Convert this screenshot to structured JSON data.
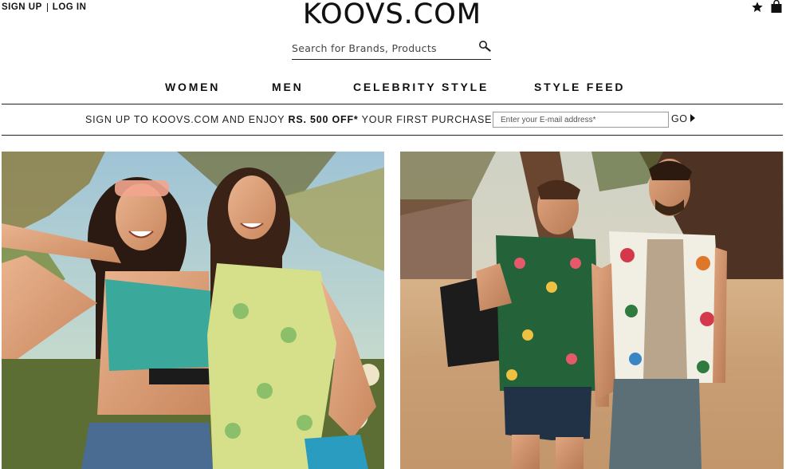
{
  "header": {
    "signup_label": "SIGN UP",
    "login_label": "LOG IN",
    "logo_text": "KOOVS.COM",
    "wishlist_icon": "star-icon",
    "bag_icon": "shopping-bag-icon"
  },
  "search": {
    "placeholder": "Search for Brands, Products",
    "icon": "search-icon"
  },
  "nav": {
    "items": [
      {
        "label": "WOMEN"
      },
      {
        "label": "MEN"
      },
      {
        "label": "CELEBRITY STYLE"
      },
      {
        "label": "STYLE FEED"
      }
    ]
  },
  "promo": {
    "text_before": "SIGN UP TO KOOVS.COM AND ENJOY ",
    "highlight": "RS. 500 OFF*",
    "text_after": " YOUR FIRST PURCHASE",
    "email_placeholder": "Enter your E-mail address*",
    "go_label": "GO",
    "go_icon": "play-arrow-icon"
  },
  "banners": {
    "women": {
      "icon": "women-collection-photo"
    },
    "men": {
      "icon": "men-collection-photo"
    }
  },
  "colors": {
    "text": "#111111",
    "rule": "#222222",
    "sand": "#d9b184",
    "sky": "#b8d5e5"
  }
}
